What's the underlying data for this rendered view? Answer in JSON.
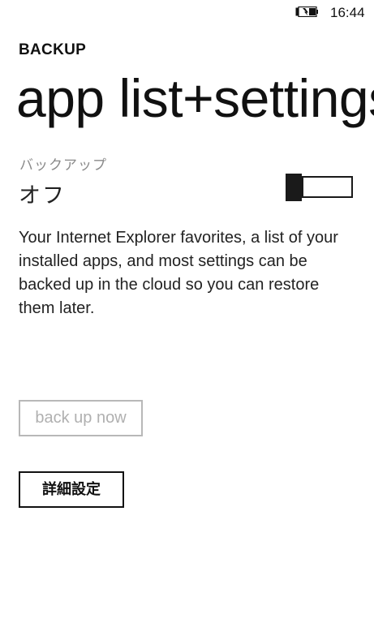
{
  "status_bar": {
    "time": "16:44",
    "battery_icon": "battery-charging-icon"
  },
  "header": {
    "section": "BACKUP",
    "title": "app list+settings"
  },
  "backup_toggle": {
    "label": "バックアップ",
    "state": "オフ",
    "on": false
  },
  "description": "Your Internet Explorer favorites, a list of your installed apps, and most settings can be backed up in the cloud so you can restore them later.",
  "buttons": {
    "back_up_now": "back up now",
    "back_up_now_enabled": false,
    "advanced": "詳細設定"
  }
}
